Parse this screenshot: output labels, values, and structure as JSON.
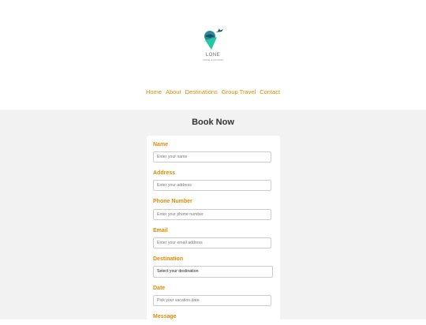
{
  "brand": {
    "name": "LONE",
    "tagline": "TRAVEL & VACATION",
    "colors": {
      "teal": "#2b8a9a",
      "green": "#29c5a7",
      "dark": "#1f4e5f"
    }
  },
  "nav": {
    "items": [
      "Home",
      "About",
      "Destinations",
      "Group Travel",
      "Contact"
    ],
    "color": "#e08a00"
  },
  "form": {
    "title": "Book Now",
    "fields": [
      {
        "label": "Name",
        "placeholder": "Enter your name"
      },
      {
        "label": "Address",
        "placeholder": "Enter your address"
      },
      {
        "label": "Phone Number",
        "placeholder": "Enter your phone number"
      },
      {
        "label": "Email",
        "placeholder": "Enter your email address"
      },
      {
        "label": "Destination",
        "value": "Select your destination"
      },
      {
        "label": "Date",
        "placeholder": "Pick your vacation date"
      },
      {
        "label": "Message"
      }
    ]
  }
}
